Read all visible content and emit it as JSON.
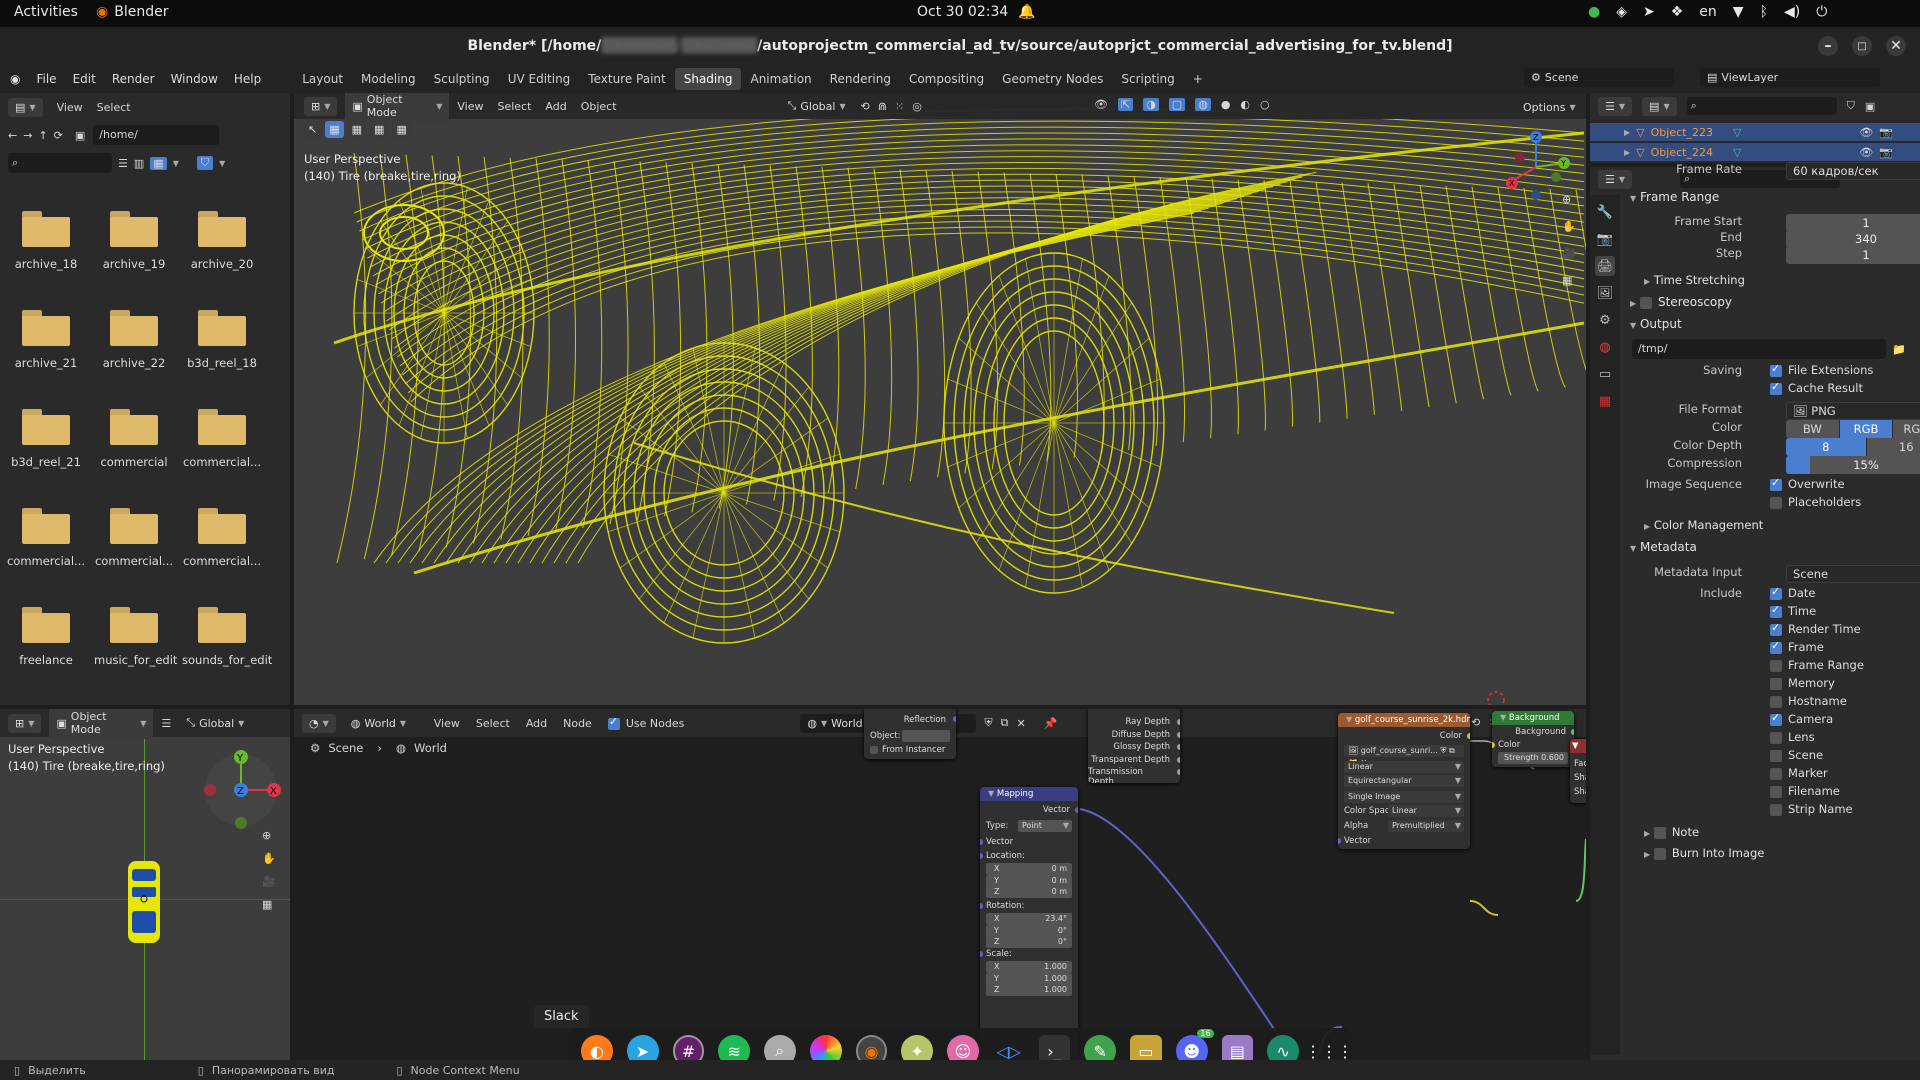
{
  "topbar": {
    "activities": "Activities",
    "app": "Blender",
    "clock": "Oct 30  02:34",
    "lang": "en"
  },
  "titlebar": {
    "title": "Blender* [/home/",
    "title_blurred": "▓▓▓▓▓▓▓/▓▓▓▓▓▓▓",
    "title_rest": "/autoprojectm_commercial_ad_tv/source/autoprjct_commercial_advertising_for_tv.blend]"
  },
  "menu": {
    "items": [
      "File",
      "Edit",
      "Render",
      "Window",
      "Help"
    ]
  },
  "workspaces": [
    "Layout",
    "Modeling",
    "Sculpting",
    "UV Editing",
    "Texture Paint",
    "Shading",
    "Animation",
    "Rendering",
    "Compositing",
    "Geometry Nodes",
    "Scripting"
  ],
  "active_workspace": "Shading",
  "scene": {
    "name": "Scene",
    "view_layer": "ViewLayer"
  },
  "filebrowser": {
    "menu": [
      "View",
      "Select"
    ],
    "path": "/home/",
    "folders": [
      "archive_18",
      "archive_19",
      "archive_20",
      "archive_21",
      "archive_22",
      "b3d_reel_18",
      "b3d_reel_21",
      "commercial",
      "commercial...",
      "commercial...",
      "commercial...",
      "commercial...",
      "freelance",
      "music_for_edit",
      "sounds_for_edit"
    ]
  },
  "viewport": {
    "mode": "Object Mode",
    "menu": [
      "View",
      "Select",
      "Add",
      "Object"
    ],
    "orientation": "Global",
    "options": "Options",
    "perspective": "User Perspective",
    "object": "(140) Tire (breake,tire,ring)",
    "wire_color": "#e6e60a"
  },
  "outliner": {
    "items": [
      "Object_223",
      "Object_224"
    ]
  },
  "properties": {
    "frame_rate_label": "Frame Rate",
    "frame_rate": "60 кадров/сек",
    "frame_range": "Frame Range",
    "frame_start_label": "Frame Start",
    "frame_start": "1",
    "end_label": "End",
    "end": "340",
    "step_label": "Step",
    "step": "1",
    "time_stretching": "Time Stretching",
    "stereoscopy": "Stereoscopy",
    "output": "Output",
    "path": "/tmp/",
    "saving_label": "Saving",
    "file_ext": "File Extensions",
    "cache": "Cache Result",
    "format_label": "File Format",
    "format": "PNG",
    "color_label": "Color",
    "color_opts": [
      "BW",
      "RGB",
      "RGBA"
    ],
    "depth_label": "Color Depth",
    "depth_opts": [
      "8",
      "16"
    ],
    "compression_label": "Compression",
    "compression": "15%",
    "compression_value": 0.15,
    "seq_label": "Image Sequence",
    "overwrite": "Overwrite",
    "placeholders": "Placeholders",
    "color_mgmt": "Color Management",
    "metadata": "Metadata",
    "meta_input_label": "Metadata Input",
    "meta_input": "Scene",
    "include_label": "Include",
    "include": [
      {
        "label": "Date",
        "on": true
      },
      {
        "label": "Time",
        "on": true
      },
      {
        "label": "Render Time",
        "on": true
      },
      {
        "label": "Frame",
        "on": true
      },
      {
        "label": "Frame Range",
        "on": false
      },
      {
        "label": "Memory",
        "on": false
      },
      {
        "label": "Hostname",
        "on": false
      },
      {
        "label": "Camera",
        "on": true
      },
      {
        "label": "Lens",
        "on": false
      },
      {
        "label": "Scene",
        "on": false
      },
      {
        "label": "Marker",
        "on": false
      },
      {
        "label": "Filename",
        "on": false
      },
      {
        "label": "Strip Name",
        "on": false
      }
    ],
    "note": "Note",
    "burn": "Burn Into Image"
  },
  "lowerleft": {
    "mode": "Object Mode",
    "orientation": "Global",
    "perspective": "User Perspective",
    "object": "(140) Tire (breake,tire,ring)"
  },
  "nodeeditor": {
    "type": "World",
    "menu": [
      "View",
      "Select",
      "Add",
      "Node"
    ],
    "use_nodes": "Use Nodes",
    "world": "World",
    "breadcrumb_scene": "Scene",
    "breadcrumb_world": "World",
    "texcoord": {
      "reflection": "Reflection",
      "object": "Object:",
      "from_instancer": "From Instancer"
    },
    "lightpath": [
      "Ray Depth",
      "Diffuse Depth",
      "Glossy Depth",
      "Transparent Depth",
      "Transmission Depth"
    ],
    "mapping": {
      "title": "Mapping",
      "vector_out": "Vector",
      "type_label": "Type:",
      "type": "Point",
      "vector_in": "Vector",
      "location": "Location:",
      "loc": [
        "0 m",
        "0 m",
        "0 m"
      ],
      "rotation": "Rotation:",
      "rot": [
        "23.4°",
        "0°",
        "0°"
      ],
      "scale": "Scale:",
      "scl": [
        "1.000",
        "1.000",
        "1.000"
      ]
    },
    "env": {
      "title": "golf_course_sunrise_2k.hdr",
      "color": "Color",
      "image": "golf_course_sunri...",
      "interp": "Linear",
      "proj": "Equirectangular",
      "source": "Single Image",
      "cs_label": "Color Space",
      "cs": "Linear",
      "alpha_label": "Alpha",
      "alpha": "Premultiplied",
      "vector": "Vector"
    },
    "background": {
      "title": "Background",
      "out": "Background",
      "color": "Color",
      "strength_label": "Strength",
      "strength": "0.600"
    },
    "right_sockets": [
      "Fac",
      "Shad",
      "Shad"
    ],
    "tooltip": "Slack"
  },
  "statusbar": {
    "select": "Выделить",
    "pan": "Панорамировать вид",
    "ctx": "Node Context Menu"
  },
  "dock": {
    "discord_badge": "16"
  }
}
